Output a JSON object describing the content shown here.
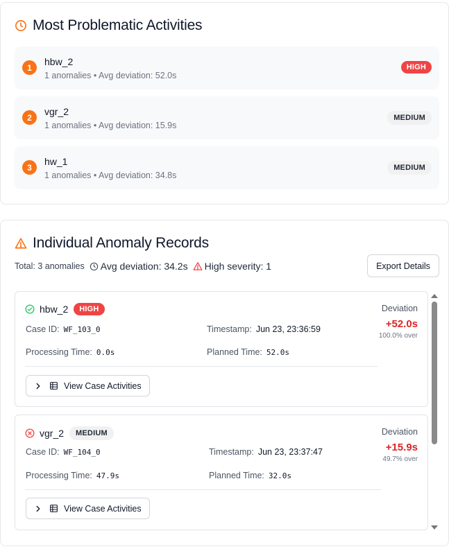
{
  "problematic": {
    "title": "Most Problematic Activities",
    "items": [
      {
        "rank": "1",
        "name": "hbw_2",
        "meta": "1 anomalies • Avg deviation: 52.0s",
        "severity": "HIGH"
      },
      {
        "rank": "2",
        "name": "vgr_2",
        "meta": "1 anomalies • Avg deviation: 15.9s",
        "severity": "MEDIUM"
      },
      {
        "rank": "3",
        "name": "hw_1",
        "meta": "1 anomalies • Avg deviation: 34.8s",
        "severity": "MEDIUM"
      }
    ]
  },
  "records": {
    "title": "Individual Anomaly Records",
    "summary": {
      "total": "Total: 3 anomalies",
      "avg": "Avg deviation: 34.2s",
      "high": "High severity: 1"
    },
    "export_label": "Export Details",
    "labels": {
      "case_id": "Case ID:",
      "timestamp": "Timestamp:",
      "processing": "Processing Time:",
      "planned": "Planned Time:",
      "deviation": "Deviation",
      "view": "View Case Activities"
    },
    "items": [
      {
        "name": "hbw_2",
        "severity": "HIGH",
        "status_icon": "check-circle-icon",
        "case_id": "WF_103_0",
        "timestamp": "Jun 23, 23:36:59",
        "processing": "0.0s",
        "planned": "52.0s",
        "deviation": "+52.0s",
        "over": "100.0% over"
      },
      {
        "name": "vgr_2",
        "severity": "MEDIUM",
        "status_icon": "x-circle-icon",
        "case_id": "WF_104_0",
        "timestamp": "Jun 23, 23:37:47",
        "processing": "47.9s",
        "planned": "32.0s",
        "deviation": "+15.9s",
        "over": "49.7% over"
      }
    ]
  },
  "colors": {
    "accent_orange": "#f97316",
    "high_red": "#ef4444",
    "deviation_red": "#dc2626",
    "success_green": "#22c55e"
  }
}
